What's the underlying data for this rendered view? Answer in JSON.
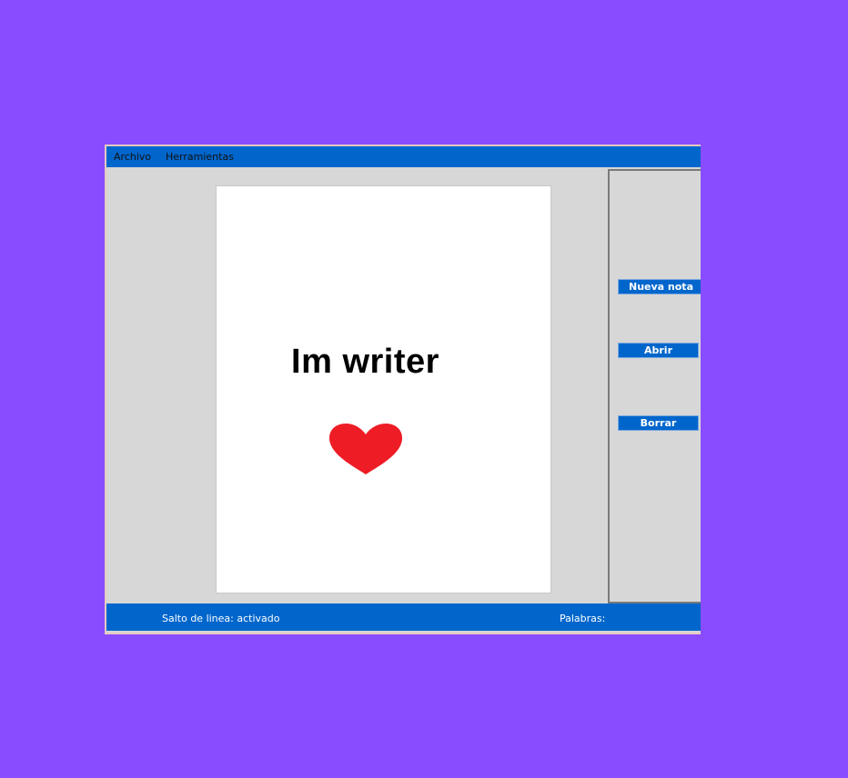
{
  "menu": {
    "archivo": "Archivo",
    "herramientas": "Herramientas"
  },
  "document": {
    "text": "Im writer",
    "decoration_icon": "heart-icon",
    "heart_color": "#ee1c25"
  },
  "side_panel": {
    "nueva_nota": "Nueva nota",
    "abrir": "Abrir",
    "borrar": "Borrar"
  },
  "status": {
    "salto_de_linea": "Salto de linea: activado",
    "palabras": "Palabras:"
  },
  "colors": {
    "background": "#8a4cff",
    "accent": "#0066cc",
    "panel": "#d7d7d7"
  }
}
